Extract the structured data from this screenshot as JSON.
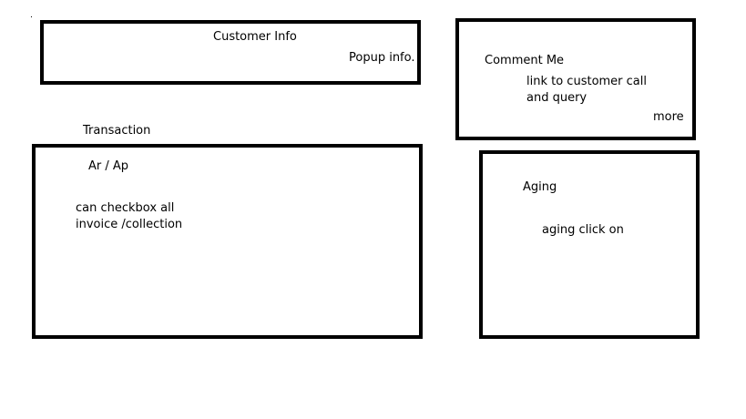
{
  "customer_info": {
    "title": "Customer Info",
    "popup_link": "Popup info."
  },
  "comment": {
    "title": "Comment Me",
    "description_line1": "link to customer call",
    "description_line2": "and query",
    "more_link": "more"
  },
  "transaction": {
    "heading": "Transaction",
    "tabs_label": "Ar /  Ap",
    "note_line1": "can checkbox  all",
    "note_line2": "invoice /collection"
  },
  "aging": {
    "title": "Aging",
    "note": "aging click on"
  }
}
